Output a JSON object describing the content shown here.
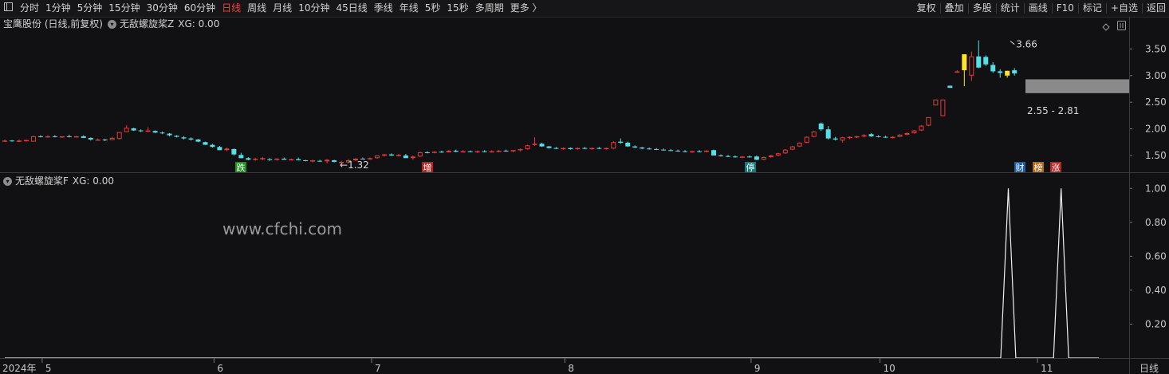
{
  "toolbar": {
    "menu_icon": "menu-icon",
    "periods": [
      "分时",
      "1分钟",
      "5分钟",
      "15分钟",
      "30分钟",
      "60分钟",
      "日线",
      "周线",
      "月线",
      "10分钟",
      "45日线",
      "季线",
      "年线",
      "5秒",
      "15秒",
      "多周期",
      "更多 〉"
    ],
    "active_period": "日线",
    "actions": [
      "复权",
      "叠加",
      "多股",
      "统计",
      "画线",
      "F10",
      "标记",
      "+自选",
      "返回"
    ]
  },
  "main_panel": {
    "stock_title": "宝鹰股份 (日线,前复权)",
    "indicator_label": "无敌螺旋桨Z",
    "indicator_value": "XG: 0.00",
    "settings_icon": "diamond-icon",
    "scroll_icon": "scroll-icon"
  },
  "sub_panel": {
    "indicator_label": "无敌螺旋桨F",
    "indicator_value": "XG: 0.00"
  },
  "watermark": "www.cfchi.com",
  "footer": {
    "period_label": "日线"
  },
  "chart_data": [
    {
      "type": "candlestick",
      "y_ticks": [
        "3.50",
        "3.00",
        "2.50",
        "2.00",
        "1.50"
      ],
      "ylim": [
        1.2,
        3.85
      ],
      "x_labels": [
        "2024年",
        "5",
        "6",
        "7",
        "8",
        "9",
        "10",
        "11"
      ],
      "annotations": {
        "low_label": "←1.32",
        "high_label": "3.66",
        "zone_label": "2.55 - 2.81",
        "zone_range": [
          2.55,
          2.81
        ]
      },
      "markers": [
        {
          "label": "跌",
          "color": "#1f8f1f"
        },
        {
          "label": "增",
          "color": "#b8231f"
        },
        {
          "label": "停",
          "color": "#147a7a"
        },
        {
          "label": "财",
          "color": "#1e5fa0"
        },
        {
          "label": "榜",
          "color": "#b86a10"
        },
        {
          "label": "涨",
          "color": "#b8231f"
        }
      ],
      "candles": [
        [
          1.78,
          1.8,
          1.76,
          1.78
        ],
        [
          1.78,
          1.79,
          1.76,
          1.77
        ],
        [
          1.77,
          1.8,
          1.75,
          1.78
        ],
        [
          1.77,
          1.8,
          1.76,
          1.79
        ],
        [
          1.76,
          1.87,
          1.76,
          1.86
        ],
        [
          1.86,
          1.88,
          1.84,
          1.85
        ],
        [
          1.84,
          1.88,
          1.84,
          1.86
        ],
        [
          1.86,
          1.88,
          1.84,
          1.85
        ],
        [
          1.84,
          1.86,
          1.83,
          1.86
        ],
        [
          1.86,
          1.89,
          1.84,
          1.85
        ],
        [
          1.85,
          1.87,
          1.84,
          1.86
        ],
        [
          1.86,
          1.88,
          1.84,
          1.83
        ],
        [
          1.83,
          1.84,
          1.78,
          1.8
        ],
        [
          1.79,
          1.82,
          1.78,
          1.8
        ],
        [
          1.8,
          1.81,
          1.77,
          1.79
        ],
        [
          1.79,
          1.85,
          1.79,
          1.83
        ],
        [
          1.81,
          1.94,
          1.8,
          1.94
        ],
        [
          1.94,
          2.07,
          1.94,
          2.02
        ],
        [
          2.01,
          2.02,
          1.96,
          1.97
        ],
        [
          1.97,
          1.99,
          1.94,
          1.96
        ],
        [
          1.96,
          2.03,
          1.94,
          1.97
        ],
        [
          1.96,
          1.97,
          1.92,
          1.93
        ],
        [
          1.93,
          1.95,
          1.9,
          1.92
        ],
        [
          1.91,
          1.92,
          1.86,
          1.88
        ],
        [
          1.87,
          1.88,
          1.84,
          1.85
        ],
        [
          1.84,
          1.86,
          1.8,
          1.82
        ],
        [
          1.82,
          1.84,
          1.78,
          1.8
        ],
        [
          1.8,
          1.81,
          1.75,
          1.76
        ],
        [
          1.75,
          1.76,
          1.7,
          1.7
        ],
        [
          1.7,
          1.72,
          1.65,
          1.66
        ],
        [
          1.66,
          1.68,
          1.6,
          1.6
        ],
        [
          1.6,
          1.65,
          1.58,
          1.63
        ],
        [
          1.62,
          1.63,
          1.5,
          1.52
        ],
        [
          1.51,
          1.55,
          1.45,
          1.45
        ],
        [
          1.45,
          1.47,
          1.41,
          1.42
        ],
        [
          1.42,
          1.45,
          1.4,
          1.44
        ],
        [
          1.44,
          1.47,
          1.41,
          1.45
        ],
        [
          1.43,
          1.45,
          1.4,
          1.42
        ],
        [
          1.42,
          1.45,
          1.4,
          1.44
        ],
        [
          1.44,
          1.46,
          1.42,
          1.42
        ],
        [
          1.42,
          1.44,
          1.41,
          1.43
        ],
        [
          1.43,
          1.46,
          1.41,
          1.41
        ],
        [
          1.41,
          1.42,
          1.39,
          1.4
        ],
        [
          1.4,
          1.42,
          1.37,
          1.41
        ],
        [
          1.4,
          1.42,
          1.38,
          1.39
        ],
        [
          1.39,
          1.43,
          1.35,
          1.42
        ],
        [
          1.41,
          1.42,
          1.37,
          1.38
        ],
        [
          1.38,
          1.4,
          1.32,
          1.38
        ],
        [
          1.37,
          1.43,
          1.35,
          1.41
        ],
        [
          1.41,
          1.45,
          1.39,
          1.44
        ],
        [
          1.44,
          1.46,
          1.42,
          1.43
        ],
        [
          1.43,
          1.46,
          1.42,
          1.45
        ],
        [
          1.45,
          1.5,
          1.44,
          1.5
        ],
        [
          1.5,
          1.53,
          1.48,
          1.52
        ],
        [
          1.52,
          1.54,
          1.49,
          1.5
        ],
        [
          1.5,
          1.53,
          1.48,
          1.51
        ],
        [
          1.5,
          1.53,
          1.47,
          1.45
        ],
        [
          1.45,
          1.5,
          1.42,
          1.48
        ],
        [
          1.48,
          1.57,
          1.47,
          1.56
        ],
        [
          1.56,
          1.58,
          1.54,
          1.55
        ],
        [
          1.55,
          1.58,
          1.54,
          1.57
        ],
        [
          1.57,
          1.59,
          1.55,
          1.56
        ],
        [
          1.56,
          1.6,
          1.56,
          1.59
        ],
        [
          1.59,
          1.61,
          1.56,
          1.57
        ],
        [
          1.57,
          1.6,
          1.56,
          1.58
        ],
        [
          1.58,
          1.59,
          1.56,
          1.57
        ],
        [
          1.57,
          1.59,
          1.55,
          1.58
        ],
        [
          1.58,
          1.6,
          1.56,
          1.57
        ],
        [
          1.57,
          1.6,
          1.56,
          1.58
        ],
        [
          1.58,
          1.6,
          1.56,
          1.59
        ],
        [
          1.59,
          1.61,
          1.57,
          1.58
        ],
        [
          1.58,
          1.6,
          1.56,
          1.6
        ],
        [
          1.6,
          1.63,
          1.58,
          1.62
        ],
        [
          1.62,
          1.7,
          1.61,
          1.69
        ],
        [
          1.7,
          1.84,
          1.68,
          1.72
        ],
        [
          1.72,
          1.74,
          1.66,
          1.67
        ],
        [
          1.67,
          1.68,
          1.63,
          1.64
        ],
        [
          1.64,
          1.66,
          1.62,
          1.63
        ],
        [
          1.63,
          1.65,
          1.61,
          1.64
        ],
        [
          1.64,
          1.65,
          1.61,
          1.62
        ],
        [
          1.62,
          1.65,
          1.61,
          1.64
        ],
        [
          1.64,
          1.66,
          1.62,
          1.63
        ],
        [
          1.63,
          1.65,
          1.61,
          1.64
        ],
        [
          1.64,
          1.66,
          1.62,
          1.63
        ],
        [
          1.63,
          1.65,
          1.61,
          1.64
        ],
        [
          1.63,
          1.77,
          1.62,
          1.75
        ],
        [
          1.76,
          1.82,
          1.72,
          1.74
        ],
        [
          1.74,
          1.76,
          1.66,
          1.67
        ],
        [
          1.67,
          1.69,
          1.64,
          1.65
        ],
        [
          1.65,
          1.66,
          1.62,
          1.63
        ],
        [
          1.63,
          1.65,
          1.61,
          1.62
        ],
        [
          1.62,
          1.64,
          1.6,
          1.61
        ],
        [
          1.61,
          1.63,
          1.59,
          1.6
        ],
        [
          1.6,
          1.62,
          1.58,
          1.59
        ],
        [
          1.59,
          1.61,
          1.57,
          1.58
        ],
        [
          1.58,
          1.6,
          1.56,
          1.57
        ],
        [
          1.57,
          1.59,
          1.55,
          1.58
        ],
        [
          1.58,
          1.6,
          1.56,
          1.57
        ],
        [
          1.57,
          1.6,
          1.56,
          1.59
        ],
        [
          1.6,
          1.61,
          1.55,
          1.5
        ],
        [
          1.5,
          1.52,
          1.48,
          1.49
        ],
        [
          1.49,
          1.51,
          1.47,
          1.48
        ],
        [
          1.48,
          1.5,
          1.46,
          1.47
        ],
        [
          1.47,
          1.49,
          1.45,
          1.48
        ],
        [
          1.48,
          1.5,
          1.46,
          1.47
        ],
        [
          1.48,
          1.5,
          1.41,
          1.42
        ],
        [
          1.42,
          1.48,
          1.41,
          1.47
        ],
        [
          1.47,
          1.51,
          1.46,
          1.5
        ],
        [
          1.5,
          1.55,
          1.49,
          1.54
        ],
        [
          1.54,
          1.62,
          1.53,
          1.61
        ],
        [
          1.61,
          1.68,
          1.6,
          1.67
        ],
        [
          1.67,
          1.75,
          1.66,
          1.74
        ],
        [
          1.74,
          1.86,
          1.73,
          1.85
        ],
        [
          1.85,
          1.96,
          1.84,
          1.95
        ],
        [
          2.1,
          2.12,
          1.96,
          1.99
        ],
        [
          1.99,
          2.05,
          1.8,
          1.82
        ],
        [
          1.82,
          1.85,
          1.78,
          1.8
        ],
        [
          1.78,
          1.85,
          1.74,
          1.84
        ],
        [
          1.84,
          1.86,
          1.81,
          1.85
        ],
        [
          1.85,
          1.87,
          1.83,
          1.86
        ],
        [
          1.86,
          1.9,
          1.84,
          1.88
        ],
        [
          1.9,
          1.92,
          1.85,
          1.86
        ],
        [
          1.86,
          1.88,
          1.84,
          1.85
        ],
        [
          1.85,
          1.87,
          1.83,
          1.84
        ],
        [
          1.84,
          1.86,
          1.82,
          1.85
        ],
        [
          1.85,
          1.9,
          1.84,
          1.89
        ],
        [
          1.89,
          1.93,
          1.88,
          1.92
        ],
        [
          1.92,
          1.98,
          1.91,
          1.97
        ],
        [
          1.97,
          2.07,
          1.96,
          2.06
        ],
        [
          2.06,
          2.22,
          2.05,
          2.22
        ],
        [
          2.44,
          2.55,
          2.44,
          2.55
        ],
        [
          2.24,
          2.55,
          2.24,
          2.55
        ],
        [
          2.81,
          2.81,
          2.77,
          2.77
        ],
        [
          3.08,
          3.1,
          3.06,
          3.08
        ],
        [
          3.1,
          3.4,
          2.8,
          3.4
        ],
        [
          3.0,
          3.45,
          2.9,
          3.36
        ],
        [
          3.36,
          3.66,
          3.14,
          3.15
        ],
        [
          3.35,
          3.38,
          3.18,
          3.21
        ],
        [
          3.2,
          3.25,
          3.05,
          3.08
        ],
        [
          3.08,
          3.12,
          2.96,
          3.05
        ],
        [
          3.0,
          3.09,
          2.96,
          3.09
        ],
        [
          3.1,
          3.14,
          3.0,
          3.04
        ]
      ],
      "yellow_candles": [
        134,
        140
      ]
    },
    {
      "type": "line",
      "y_ticks": [
        "1.00",
        "0.80",
        "0.60",
        "0.40",
        "0.20"
      ],
      "ylim": [
        0,
        1.02
      ],
      "series": [
        {
          "values": [
            0,
            0,
            0,
            0,
            0,
            0,
            0,
            0,
            0,
            0,
            0,
            0,
            0,
            0,
            0,
            0,
            0,
            0,
            0,
            0,
            0,
            0,
            0,
            0,
            0,
            0,
            0,
            0,
            0,
            0,
            0,
            0,
            0,
            0,
            0,
            0,
            0,
            0,
            0,
            0,
            0,
            0,
            0,
            0,
            0,
            0,
            0,
            0,
            0,
            0,
            0,
            0,
            0,
            0,
            0,
            0,
            0,
            0,
            0,
            0,
            0,
            0,
            0,
            0,
            0,
            0,
            0,
            0,
            0,
            0,
            0,
            0,
            0,
            0,
            0,
            0,
            0,
            0,
            0,
            0,
            0,
            0,
            0,
            0,
            0,
            0,
            0,
            0,
            0,
            0,
            0,
            0,
            0,
            0,
            0,
            0,
            0,
            0,
            0,
            0,
            0,
            0,
            0,
            0,
            0,
            0,
            0,
            0,
            0,
            0,
            0,
            0,
            0,
            0,
            0,
            0,
            0,
            0,
            0,
            0,
            0,
            0,
            0,
            0,
            0,
            0,
            0,
            0,
            0,
            0,
            0,
            0,
            0,
            1,
            0,
            0,
            0,
            0,
            0,
            0,
            1,
            0,
            0,
            0,
            0,
            0
          ]
        }
      ]
    }
  ]
}
